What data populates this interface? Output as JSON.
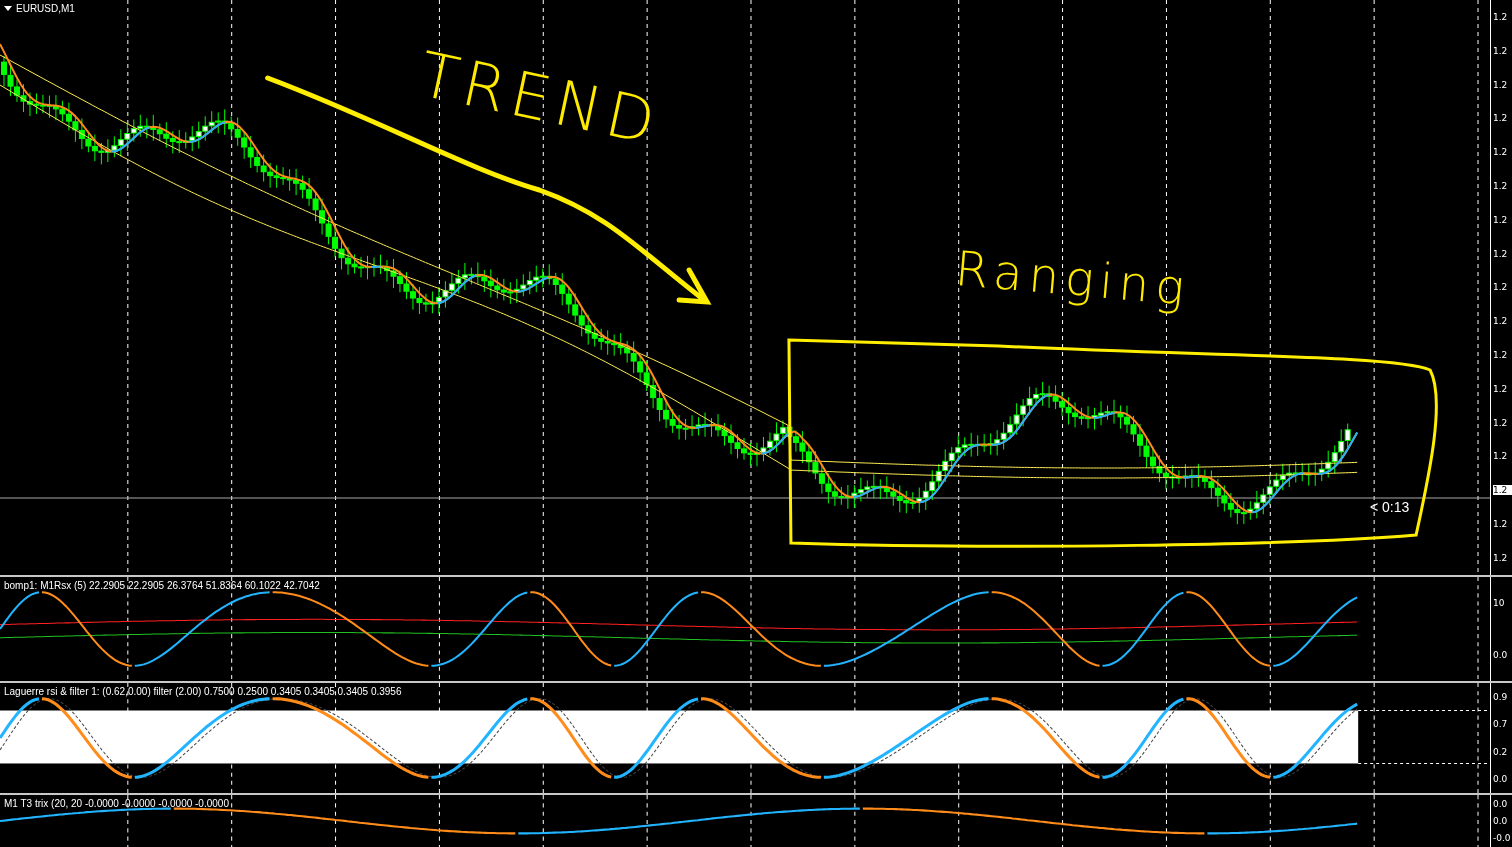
{
  "chart": {
    "symbol": "EURUSD,M1",
    "timer": "< 0:13",
    "price_labels": [
      "1.2",
      "1.2",
      "1.2",
      "1.2",
      "1.2",
      "1.2",
      "1.2",
      "1.2",
      "1.2",
      "1.2",
      "1.2",
      "1.2",
      "1.2",
      "1.2",
      "1.2",
      "1.2"
    ],
    "current_price_label": "1.2"
  },
  "annotations": [
    {
      "text": "TREND"
    },
    {
      "text": "Ranging"
    }
  ],
  "indicators": [
    {
      "kind": "rsx",
      "title": "bomp1: M1Rsx (5) 22.2905 22.2905 26.3764 51.8364 60.1022 42.7042",
      "axis_labels": [
        "10",
        "0.0"
      ]
    },
    {
      "kind": "laguerre",
      "title": "Laguerre rsi & filter 1: (0.62,0.00) filter (2.00) 0.7500 0.2500 0.3405 0.3405 0.3405 0.3956",
      "axis_labels": [
        "0.9",
        "0.7",
        "0.2",
        "0.0"
      ]
    },
    {
      "kind": "trix",
      "title": "M1 T3 trix (20, 20 -0.0000 -0.0000 -0.0000 -0.0000",
      "axis_labels": [
        "0.0",
        "0.0",
        "-0.0"
      ]
    }
  ]
}
